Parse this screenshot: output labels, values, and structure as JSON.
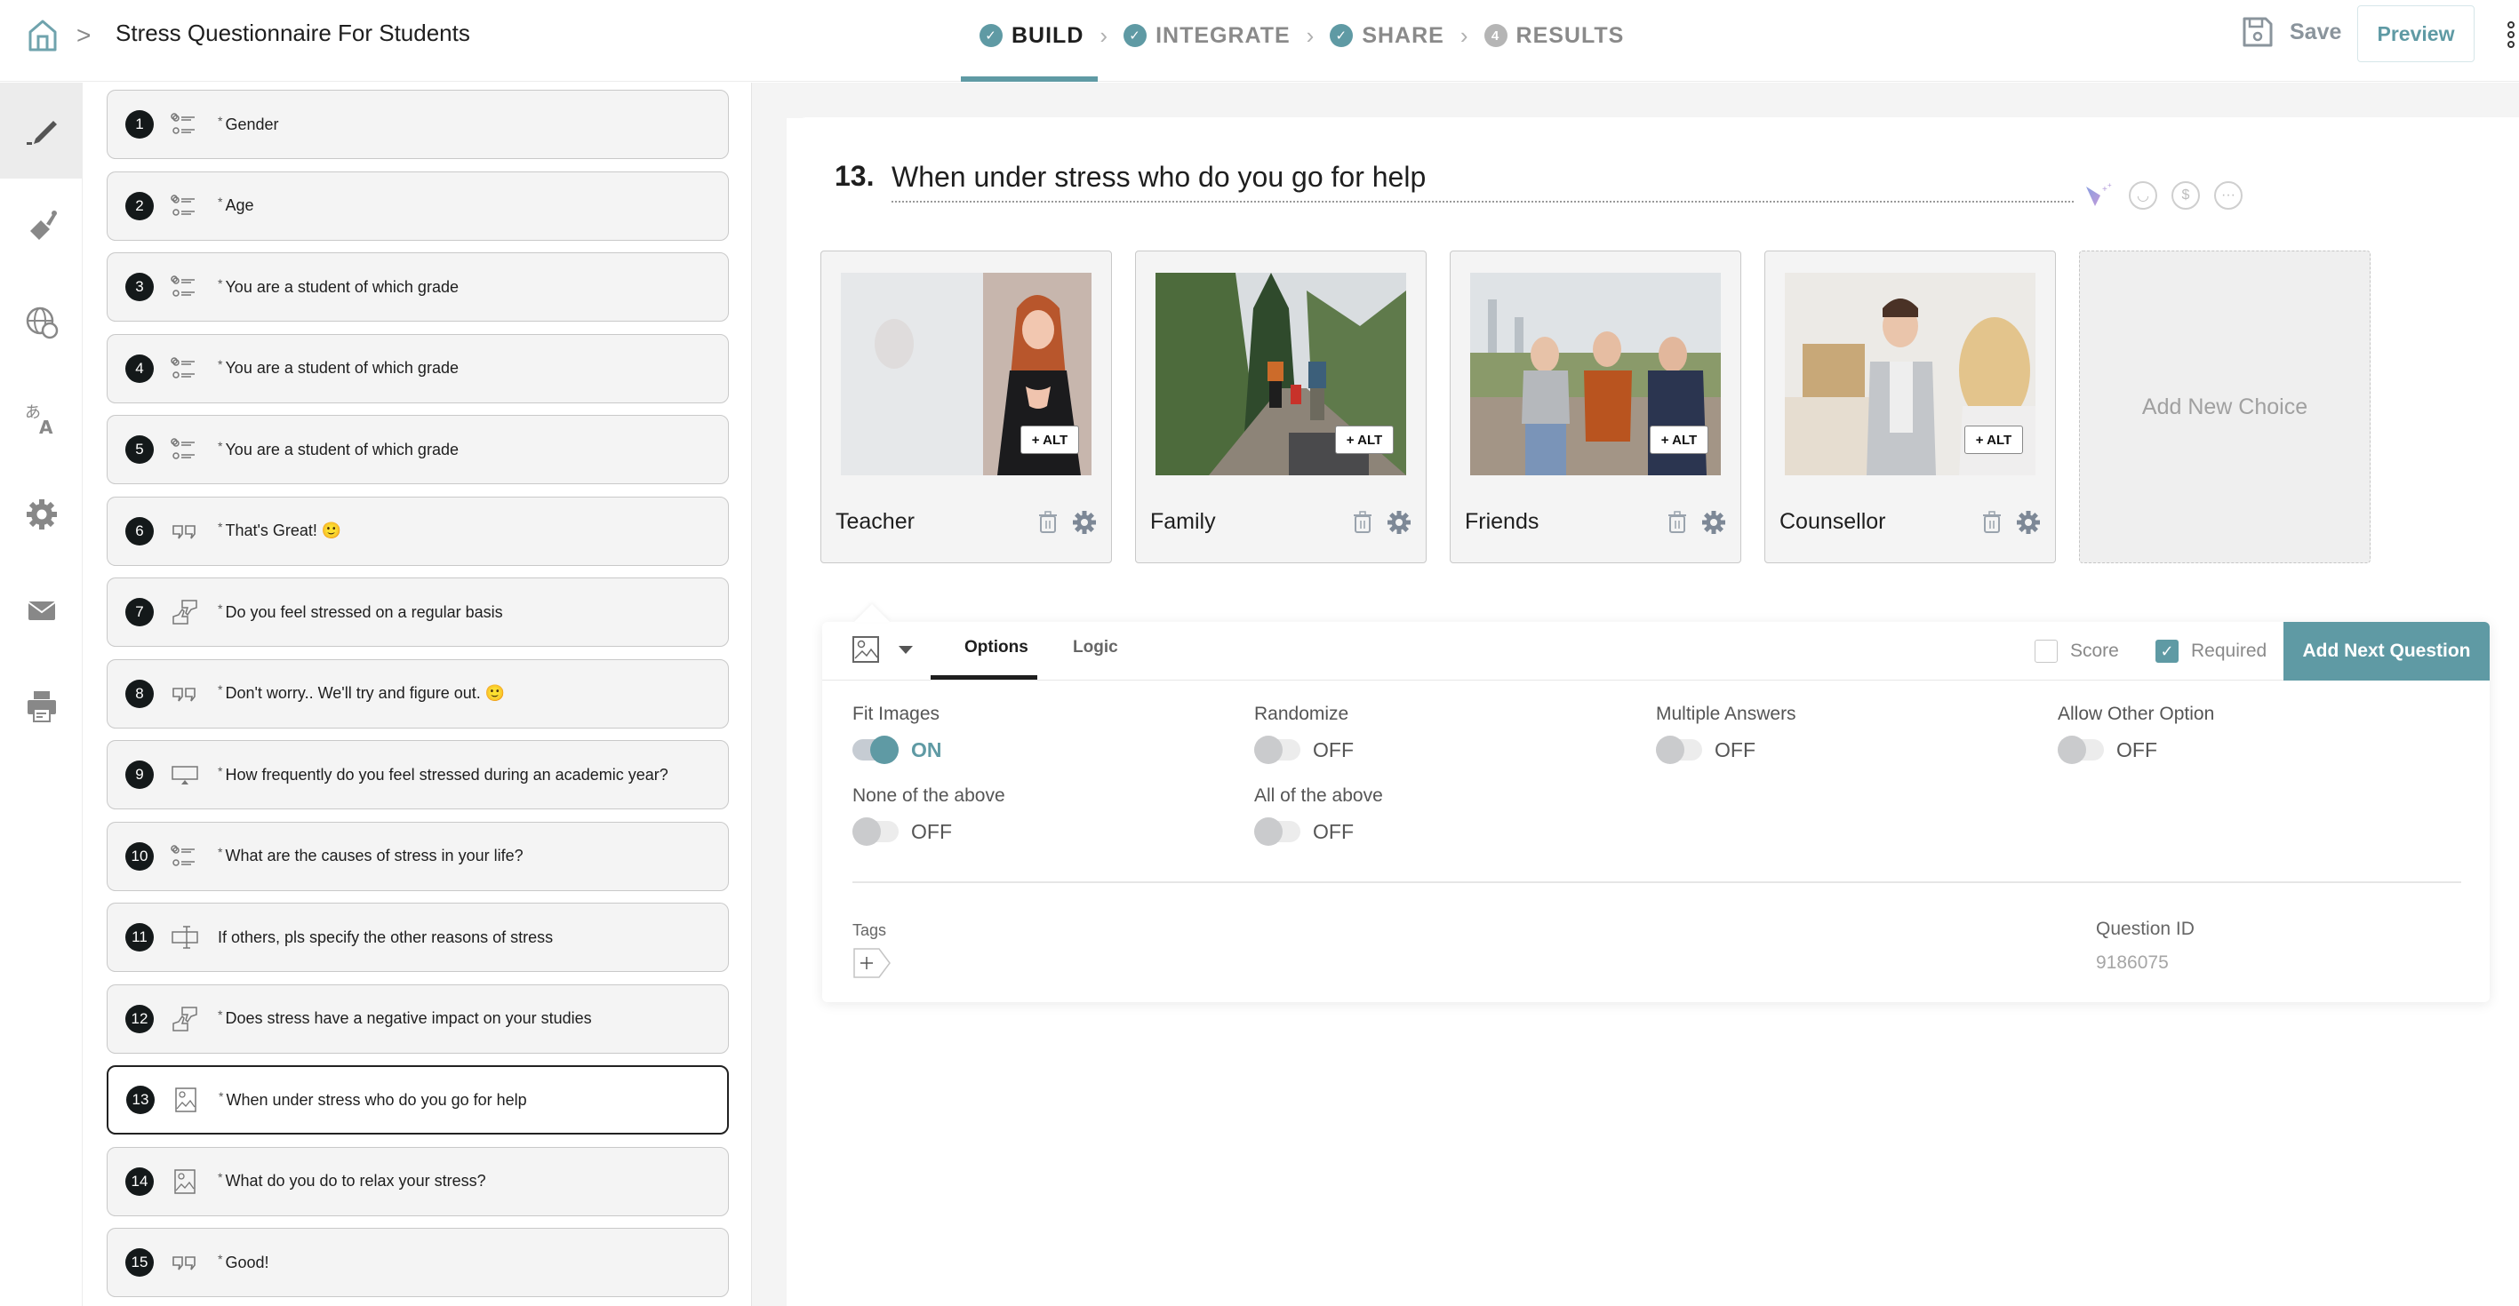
{
  "header": {
    "home_icon": "home-icon",
    "breadcrumb_separator": ">",
    "title": "Stress Questionnaire For Students",
    "steps": [
      {
        "label": "BUILD",
        "badge": "✓",
        "state": "active"
      },
      {
        "label": "INTEGRATE",
        "badge": "✓",
        "state": "done"
      },
      {
        "label": "SHARE",
        "badge": "✓",
        "state": "done"
      },
      {
        "label": "RESULTS",
        "badge": "4",
        "state": "pending"
      }
    ],
    "step_separator": "›",
    "save_label": "Save",
    "preview_label": "Preview"
  },
  "rail": [
    {
      "name": "edit",
      "icon": "pencil-icon",
      "active": true
    },
    {
      "name": "theme",
      "icon": "paint-brush-icon",
      "active": false
    },
    {
      "name": "languages-web",
      "icon": "globe-icon",
      "active": false
    },
    {
      "name": "translate",
      "icon": "translate-icon",
      "active": false
    },
    {
      "name": "settings",
      "icon": "gear-icon",
      "active": false
    },
    {
      "name": "email",
      "icon": "envelope-icon",
      "active": false
    },
    {
      "name": "print",
      "icon": "printer-icon",
      "active": false
    }
  ],
  "questions": [
    {
      "num": "1",
      "type": "multiple-choice",
      "required": true,
      "text": "Gender"
    },
    {
      "num": "2",
      "type": "multiple-choice",
      "required": true,
      "text": "Age"
    },
    {
      "num": "3",
      "type": "multiple-choice",
      "required": true,
      "text": "You are a student of which grade"
    },
    {
      "num": "4",
      "type": "multiple-choice",
      "required": true,
      "text": "You are a student of which grade"
    },
    {
      "num": "5",
      "type": "multiple-choice",
      "required": true,
      "text": "You are a student of which grade"
    },
    {
      "num": "6",
      "type": "statement",
      "required": true,
      "text": "That's Great! 🙂"
    },
    {
      "num": "7",
      "type": "thumbs",
      "required": true,
      "text": "Do you feel stressed on a regular basis"
    },
    {
      "num": "8",
      "type": "statement",
      "required": true,
      "text": "Don't worry.. We'll try and figure out. 🙂"
    },
    {
      "num": "9",
      "type": "dropdown",
      "required": true,
      "text": "How frequently do you feel stressed during an academic year?"
    },
    {
      "num": "10",
      "type": "multiple-choice",
      "required": true,
      "text": "What are the causes of stress in your life?"
    },
    {
      "num": "11",
      "type": "text-input",
      "required": false,
      "text": "If others, pls specify the other reasons of stress"
    },
    {
      "num": "12",
      "type": "thumbs",
      "required": true,
      "text": "Does stress have a negative impact on your studies"
    },
    {
      "num": "13",
      "type": "image-choice",
      "required": true,
      "text": "When under stress who do you go for help",
      "selected": true
    },
    {
      "num": "14",
      "type": "image-choice",
      "required": true,
      "text": "What do you do to relax your stress?"
    },
    {
      "num": "15",
      "type": "statement",
      "required": true,
      "text": "Good!"
    }
  ],
  "required_marker": "*",
  "editor": {
    "number": "13.",
    "question_text": "When under stress who do you go for help",
    "tool_icons": [
      "magic-wand-icon",
      "smiley-icon",
      "dollar-icon",
      "more-icon"
    ],
    "choices": [
      {
        "label": "Teacher",
        "alt_label": "+ ALT",
        "image": "teacher-photo"
      },
      {
        "label": "Family",
        "alt_label": "+ ALT",
        "image": "family-photo"
      },
      {
        "label": "Friends",
        "alt_label": "+ ALT",
        "image": "friends-photo"
      },
      {
        "label": "Counsellor",
        "alt_label": "+ ALT",
        "image": "counsellor-photo"
      }
    ],
    "add_choice_label": "Add New Choice"
  },
  "options_panel": {
    "tabs": [
      {
        "label": "Options",
        "active": true
      },
      {
        "label": "Logic",
        "active": false
      }
    ],
    "score_label": "Score",
    "score_checked": false,
    "required_label": "Required",
    "required_checked": true,
    "add_next_label": "Add Next Question",
    "toggles": [
      {
        "label": "Fit Images",
        "on": true,
        "state": "ON"
      },
      {
        "label": "Randomize",
        "on": false,
        "state": "OFF"
      },
      {
        "label": "Multiple Answers",
        "on": false,
        "state": "OFF"
      },
      {
        "label": "Allow Other Option",
        "on": false,
        "state": "OFF"
      },
      {
        "label": "None of the above",
        "on": false,
        "state": "OFF"
      },
      {
        "label": "All of the above",
        "on": false,
        "state": "OFF"
      }
    ],
    "tags_label": "Tags",
    "tag_add_symbol": "+",
    "question_id_label": "Question ID",
    "question_id": "9186075"
  },
  "colors": {
    "accent": "#5f9aa4",
    "dark": "#14191a",
    "muted": "#8a8a8a"
  }
}
